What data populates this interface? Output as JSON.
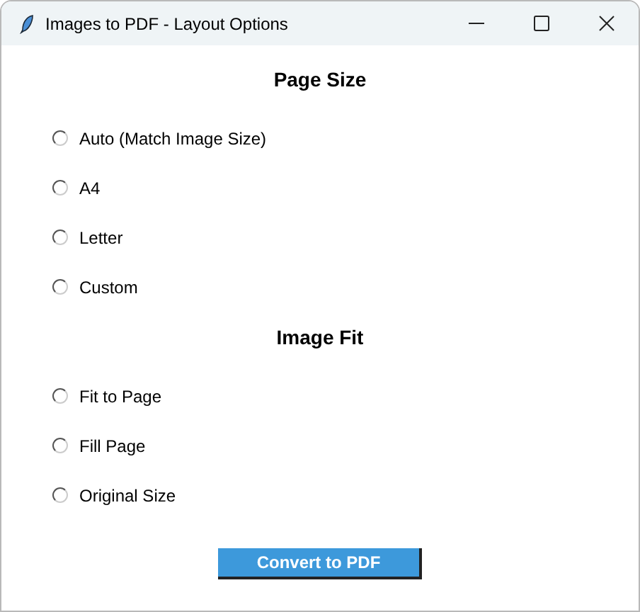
{
  "window": {
    "title": "Images to PDF - Layout Options"
  },
  "sections": [
    {
      "heading": "Page Size",
      "options": [
        {
          "label": "Auto (Match Image Size)",
          "selected": false
        },
        {
          "label": "A4",
          "selected": false
        },
        {
          "label": "Letter",
          "selected": false
        },
        {
          "label": "Custom",
          "selected": false
        }
      ]
    },
    {
      "heading": "Image Fit",
      "options": [
        {
          "label": "Fit to Page",
          "selected": false
        },
        {
          "label": "Fill Page",
          "selected": false
        },
        {
          "label": "Original Size",
          "selected": false
        }
      ]
    }
  ],
  "button": "Convert to PDF"
}
